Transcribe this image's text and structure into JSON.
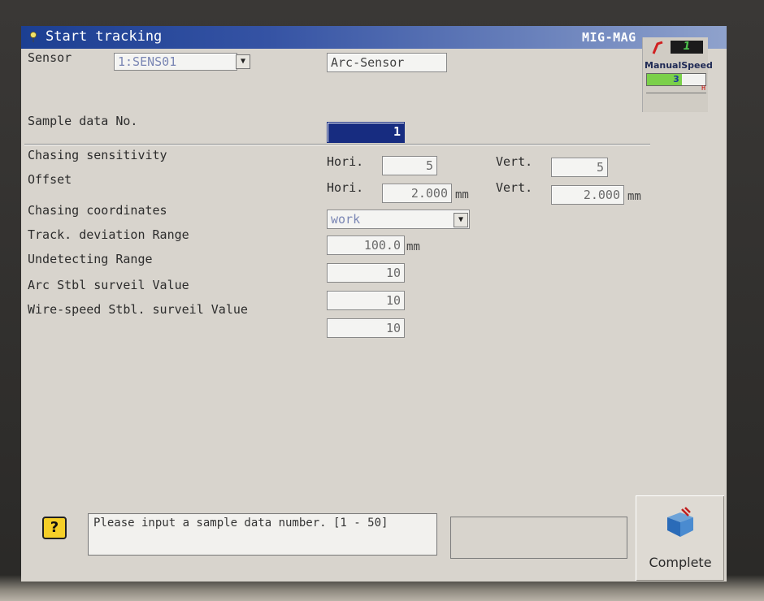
{
  "window": {
    "title": "Start tracking",
    "mode": "MIG-MAG"
  },
  "sensor": {
    "label": "Sensor",
    "value": "1:SENS01",
    "type": "Arc-Sensor"
  },
  "sample": {
    "label": "Sample data No.",
    "value": "1"
  },
  "fields": {
    "chasing_sensitivity": {
      "label": "Chasing sensitivity",
      "hori_label": "Hori.",
      "hori_value": "5",
      "vert_label": "Vert.",
      "vert_value": "5"
    },
    "offset": {
      "label": "Offset",
      "hori_label": "Hori.",
      "hori_value": "2.000",
      "hori_unit": "mm",
      "vert_label": "Vert.",
      "vert_value": "2.000",
      "vert_unit": "mm"
    },
    "chasing_coordinates": {
      "label": "Chasing coordinates",
      "value": "work"
    },
    "track_deviation": {
      "label": "Track. deviation Range",
      "value": "100.0",
      "unit": "mm"
    },
    "undetecting": {
      "label": "Undetecting Range",
      "value": "10"
    },
    "arc_stbl": {
      "label": "Arc Stbl surveil Value",
      "value": "10"
    },
    "wire_speed_stbl": {
      "label": "Wire-speed Stbl. surveil Value",
      "value": "10"
    }
  },
  "indicator": {
    "number": "1",
    "label": "ManualSpeed",
    "speed": "3",
    "speed_level_fraction": 0.6,
    "scale_high": "H"
  },
  "message": {
    "text": "Please input a sample data number.  [1 - 50]"
  },
  "complete_button": {
    "label": "Complete"
  },
  "colors": {
    "title_bar": "#1c3f92",
    "selected_field": "#172c80",
    "speed_fill": "#7bd04a"
  }
}
